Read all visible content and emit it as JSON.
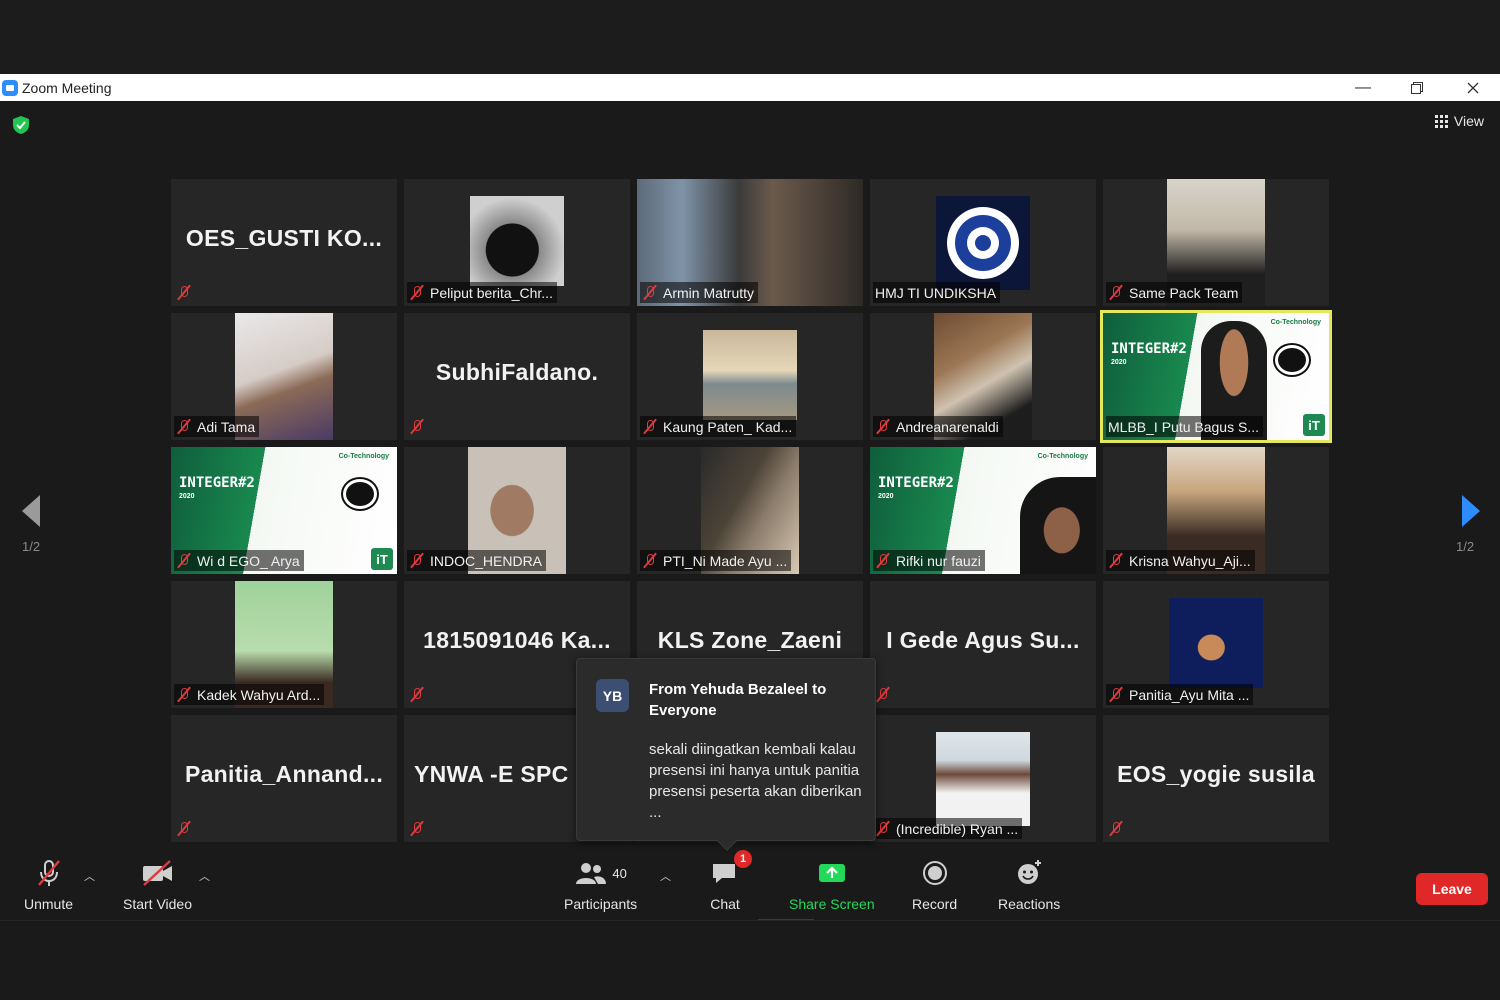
{
  "window": {
    "title": "Zoom Meeting"
  },
  "header": {
    "view_label": "View"
  },
  "pagination": {
    "left": "1/2",
    "right": "1/2"
  },
  "tiles": [
    {
      "name": "OES_GUSTI  KO...",
      "label": "",
      "type": "name"
    },
    {
      "name": "",
      "label": "Peliput berita_Chr...",
      "type": "video"
    },
    {
      "name": "",
      "label": "Armin Matrutty",
      "type": "video"
    },
    {
      "name": "",
      "label": "HMJ TI UNDIKSHA",
      "type": "logo"
    },
    {
      "name": "",
      "label": "Same Pack Team",
      "type": "video"
    },
    {
      "name": "",
      "label": "Adi Tama",
      "type": "video"
    },
    {
      "name": "SubhiFaldano.",
      "label": "",
      "type": "name"
    },
    {
      "name": "",
      "label": "Kaung Paten_ Kad...",
      "type": "video"
    },
    {
      "name": "",
      "label": "Andreanarenaldi",
      "type": "video"
    },
    {
      "name": "",
      "label": "MLBB_I Putu Bagus S...",
      "type": "integer"
    },
    {
      "name": "",
      "label": "Wi d EGO_ Arya",
      "type": "integer"
    },
    {
      "name": "",
      "label": "INDOC_HENDRA",
      "type": "video"
    },
    {
      "name": "",
      "label": "PTI_Ni Made Ayu ...",
      "type": "video"
    },
    {
      "name": "",
      "label": "Rifki nur fauzi",
      "type": "integer"
    },
    {
      "name": "",
      "label": "Krisna Wahyu_Aji...",
      "type": "video"
    },
    {
      "name": "",
      "label": "Kadek Wahyu Ard...",
      "type": "video"
    },
    {
      "name": "1815091046  Ka...",
      "label": "",
      "type": "name"
    },
    {
      "name": "KLS Zone_Zaeni",
      "label": "",
      "type": "name"
    },
    {
      "name": "I  Gede  Agus  Su...",
      "label": "",
      "type": "name"
    },
    {
      "name": "",
      "label": "Panitia_Ayu Mita ...",
      "type": "video"
    },
    {
      "name": "Panitia_Annand...",
      "label": "",
      "type": "name"
    },
    {
      "name": "YNWA  -E  SPC",
      "label": "",
      "type": "name"
    },
    {
      "name": "",
      "label": "",
      "type": "name"
    },
    {
      "name": "",
      "label": "(Incredible) Ryan ...",
      "type": "video"
    },
    {
      "name": "EOS_yogie susila",
      "label": "",
      "type": "name"
    }
  ],
  "integer_banner": {
    "title": "INTEGER#2",
    "year": "2020",
    "tag": "Co-Technology"
  },
  "chat_popup": {
    "avatar_initials": "YB",
    "from": "From Yehuda Bezaleel to Everyone",
    "message": "sekali diingatkan kembali kalau presensi ini hanya untuk panitia presensi peserta akan diberikan ..."
  },
  "toolbar": {
    "unmute": "Unmute",
    "start_video": "Start Video",
    "participants": "Participants",
    "participants_count": "40",
    "chat": "Chat",
    "chat_badge": "1",
    "share_screen": "Share Screen",
    "record": "Record",
    "reactions": "Reactions",
    "leave": "Leave"
  },
  "colors": {
    "active_speaker": "#e4e85a",
    "mute_red": "#e0393e",
    "share_green": "#23d959",
    "leave_red": "#e02828",
    "brand_blue": "#2d8cff"
  }
}
